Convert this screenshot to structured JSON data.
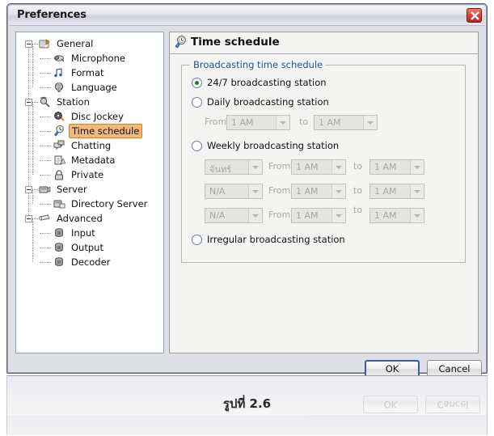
{
  "window": {
    "title": "Preferences",
    "close_icon": "close-x-icon"
  },
  "tree": {
    "items": [
      {
        "label": "General",
        "icon": "general-icon",
        "level": 0,
        "expanded": true,
        "selected": false
      },
      {
        "label": "Microphone",
        "icon": "microphone-icon",
        "level": 1,
        "expanded": null,
        "selected": false
      },
      {
        "label": "Format",
        "icon": "format-note-icon",
        "level": 1,
        "expanded": null,
        "selected": false
      },
      {
        "label": "Language",
        "icon": "language-globe-icon",
        "level": 1,
        "expanded": null,
        "selected": false
      },
      {
        "label": "Station",
        "icon": "station-antenna-icon",
        "level": 0,
        "expanded": true,
        "selected": false
      },
      {
        "label": "Disc Jockey",
        "icon": "disc-jockey-icon",
        "level": 1,
        "expanded": null,
        "selected": false
      },
      {
        "label": "Time schedule",
        "icon": "clock-icon",
        "level": 1,
        "expanded": null,
        "selected": true
      },
      {
        "label": "Chatting",
        "icon": "chatting-icon",
        "level": 1,
        "expanded": null,
        "selected": false
      },
      {
        "label": "Metadata",
        "icon": "metadata-icon",
        "level": 1,
        "expanded": null,
        "selected": false
      },
      {
        "label": "Private",
        "icon": "private-lock-icon",
        "level": 1,
        "expanded": null,
        "selected": false
      },
      {
        "label": "Server",
        "icon": "server-icon",
        "level": 0,
        "expanded": true,
        "selected": false
      },
      {
        "label": "Directory Server",
        "icon": "directory-server-icon",
        "level": 1,
        "expanded": null,
        "selected": false
      },
      {
        "label": "Advanced",
        "icon": "advanced-icon",
        "level": 0,
        "expanded": true,
        "selected": false
      },
      {
        "label": "Input",
        "icon": "input-icon",
        "level": 1,
        "expanded": null,
        "selected": false
      },
      {
        "label": "Output",
        "icon": "output-icon",
        "level": 1,
        "expanded": null,
        "selected": false
      },
      {
        "label": "Decoder",
        "icon": "decoder-icon",
        "level": 1,
        "expanded": null,
        "selected": false
      }
    ]
  },
  "panel": {
    "title": "Time schedule",
    "icon": "clock-icon",
    "group_legend": "Broadcasting time schedule",
    "options": {
      "opt_247": "24/7 broadcasting station",
      "opt_daily": "Daily broadcasting station",
      "opt_weekly": "Weekly broadcasting station",
      "opt_irregular": "Irregular broadcasting station"
    },
    "labels": {
      "from": "From",
      "to": "to"
    },
    "daily": {
      "from_value": "1 AM",
      "to_value": "1 AM"
    },
    "weekly_rows": [
      {
        "day": "จันทร์",
        "from_value": "1 AM",
        "to_value": "1 AM"
      },
      {
        "day": "N/A",
        "from_value": "1 AM",
        "to_value": "1 AM"
      },
      {
        "day": "N/A",
        "from_value": "1 AM",
        "to_value": "1 AM"
      }
    ]
  },
  "buttons": {
    "ok": "OK",
    "cancel": "Cancel"
  },
  "reflection": {
    "ok": "OK",
    "cancel": "Cancel"
  },
  "caption": "รูปที่ 2.6",
  "colors": {
    "selection_fill": "#f0b97a",
    "selection_border": "#e07b1e",
    "legend_text": "#2a4d9e",
    "radio_dot": "#0f8b23",
    "dialog_bg": "#dfdfe6",
    "panel_bg": "#f4f4f2"
  }
}
